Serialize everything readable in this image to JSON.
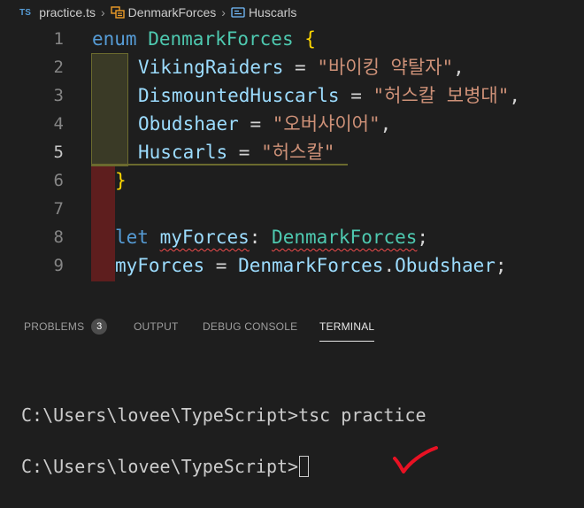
{
  "breadcrumb": {
    "file_badge": "TS",
    "file": "practice.ts",
    "enum_name": "DenmarkForces",
    "member_name": "Huscarls"
  },
  "editor": {
    "line_numbers": [
      "1",
      "2",
      "3",
      "4",
      "5",
      "6",
      "7",
      "8",
      "9"
    ],
    "active_line": "5",
    "tokens": {
      "l1_enum": "enum",
      "l1_name": "DenmarkForces",
      "l1_brace": "{",
      "l2_member": "VikingRaiders",
      "l2_eq": " = ",
      "l2_str": "\"바이킹 약탈자\"",
      "l2_comma": ",",
      "l3_member": "DismountedHuscarls",
      "l3_eq": " = ",
      "l3_str": "\"허스칼 보병대\"",
      "l3_comma": ",",
      "l4_member": "Obudshaer",
      "l4_eq": " = ",
      "l4_str": "\"오버샤이어\"",
      "l4_comma": ",",
      "l5_member": "Huscarls",
      "l5_eq": " = ",
      "l5_str": "\"허스칼\"",
      "l6_brace": "}",
      "l8_let": "let",
      "l8_var": "myForces",
      "l8_colon": ": ",
      "l8_type": "DenmarkForces",
      "l8_semi": ";",
      "l9_var": "myForces",
      "l9_eq": " = ",
      "l9_enum": "DenmarkForces",
      "l9_dot": ".",
      "l9_member": "Obudshaer",
      "l9_semi": ";"
    }
  },
  "panel": {
    "tabs": [
      {
        "label": "PROBLEMS",
        "badge": "3"
      },
      {
        "label": "OUTPUT"
      },
      {
        "label": "DEBUG CONSOLE"
      },
      {
        "label": "TERMINAL"
      }
    ],
    "active_tab": "TERMINAL"
  },
  "terminal": {
    "line1": "C:\\Users\\lovee\\TypeScript>tsc practice",
    "line2": "C:\\Users\\lovee\\TypeScript>"
  },
  "colors": {
    "keyword": "#569cd6",
    "type": "#4ec9b0",
    "property": "#9cdcfe",
    "string": "#ce9178",
    "bracket": "#ffd700",
    "annotation_check": "#e81123"
  }
}
